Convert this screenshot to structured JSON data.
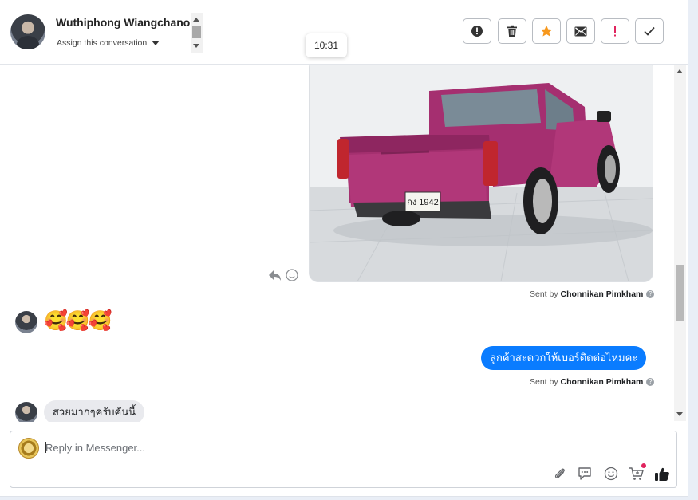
{
  "header": {
    "contact_name": "Wuthiphong Wiangchanok",
    "assign_label": "Assign this conversation",
    "time_tooltip": "10:31",
    "actions": [
      {
        "icon": "alert-circle-icon",
        "label": "Mark as spam"
      },
      {
        "icon": "trash-icon",
        "label": "Delete"
      },
      {
        "icon": "star-icon",
        "label": "Star"
      },
      {
        "icon": "envelope-icon",
        "label": "Mark as unread"
      },
      {
        "icon": "exclamation-icon",
        "label": "Follow up"
      },
      {
        "icon": "check-icon",
        "label": "Mark as done"
      }
    ]
  },
  "messages": {
    "image_plate": "กง 1942",
    "sent_by_prefix": "Sent by",
    "sent_by_1": "Chonnikan Pimkham",
    "emoji_message": "🥰🥰🥰",
    "outgoing_text": "ลูกค้าสะดวกให้เบอร์ติดต่อไหมคะ",
    "sent_by_2": "Chonnikan Pimkham",
    "incoming_text": "สวยมากๆครับคันนี้"
  },
  "composer": {
    "placeholder": "Reply in Messenger..."
  },
  "colors": {
    "accent": "#0a7cff",
    "star": "#f7981d",
    "alert": "#e0245e"
  }
}
